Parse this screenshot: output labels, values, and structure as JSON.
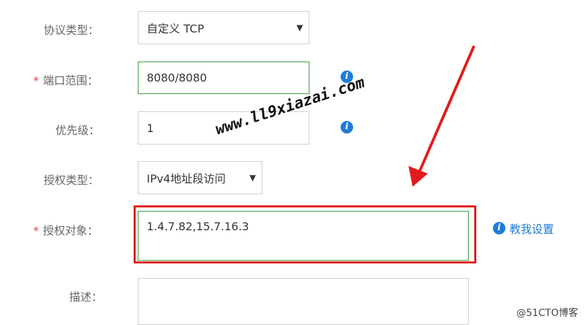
{
  "form": {
    "protocol": {
      "label": "协议类型：",
      "value": "自定义 TCP"
    },
    "port_range": {
      "label": "端口范围：",
      "required_mark": "*",
      "value": "8080/8080"
    },
    "priority": {
      "label": "优先级：",
      "value": "1"
    },
    "auth_type": {
      "label": "授权类型：",
      "value": "IPv4地址段访问"
    },
    "auth_object": {
      "label": "授权对象：",
      "required_mark": "*",
      "value": "1.4.7.82,15.7.16.3"
    },
    "description": {
      "label": "描述：",
      "value": ""
    }
  },
  "help_link": {
    "label": "教我设置"
  },
  "info_icon_glyph": "i",
  "watermark": "www.ll9xiazai.com",
  "corner_mark": "@51CTO博客",
  "colors": {
    "accent_blue": "#1e7cd8",
    "highlight_red": "#e11b1b",
    "valid_green": "#3e9a3e",
    "required_red": "#e4393c"
  }
}
